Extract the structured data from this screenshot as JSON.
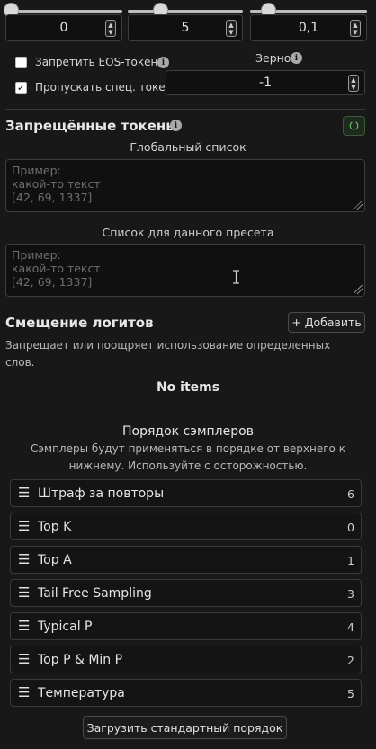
{
  "sliders": [
    {
      "value": "0",
      "fill": 0.02
    },
    {
      "value": "5",
      "fill": 0.3
    },
    {
      "value": "0,1",
      "fill": 0.12
    }
  ],
  "ban_eos": {
    "label": "Запретить EOS-токен",
    "checked": false
  },
  "skip_special": {
    "label": "Пропускать спец. токены",
    "checked": true
  },
  "seed": {
    "label": "Зерно",
    "value": "-1"
  },
  "banned_tokens": {
    "title": "Запрещённые токены",
    "global_label": "Глобальный список",
    "global_placeholder_lines": [
      "Пример:",
      "какой-то текст",
      "[42, 69, 1337]"
    ],
    "preset_label": "Список для данного пресета",
    "preset_placeholder_lines": [
      "Пример:",
      "какой-то текст",
      "[42, 69, 1337]"
    ]
  },
  "logit_bias": {
    "title": "Смещение логитов",
    "add_label": "+ Добавить",
    "description_line1": "Запрещает или поощряет использование определенных",
    "description_line2": "слов.",
    "empty_text": "No items"
  },
  "sampler_order": {
    "title": "Порядок сэмплеров",
    "description_line1": "Сэмплеры будут применяться в порядке от верхнего к",
    "description_line2": "нижнему. Используйте с осторожностью.",
    "items": [
      {
        "name": "Штраф за повторы",
        "index": "6"
      },
      {
        "name": "Top K",
        "index": "0"
      },
      {
        "name": "Top A",
        "index": "1"
      },
      {
        "name": "Tail Free Sampling",
        "index": "3"
      },
      {
        "name": "Typical P",
        "index": "4"
      },
      {
        "name": "Top P & Min P",
        "index": "2"
      },
      {
        "name": "Температура",
        "index": "5"
      }
    ],
    "reset_label": "Загрузить стандартный порядок"
  },
  "colors": {
    "background": "#181818",
    "toggle_on": "#7bd27b"
  }
}
